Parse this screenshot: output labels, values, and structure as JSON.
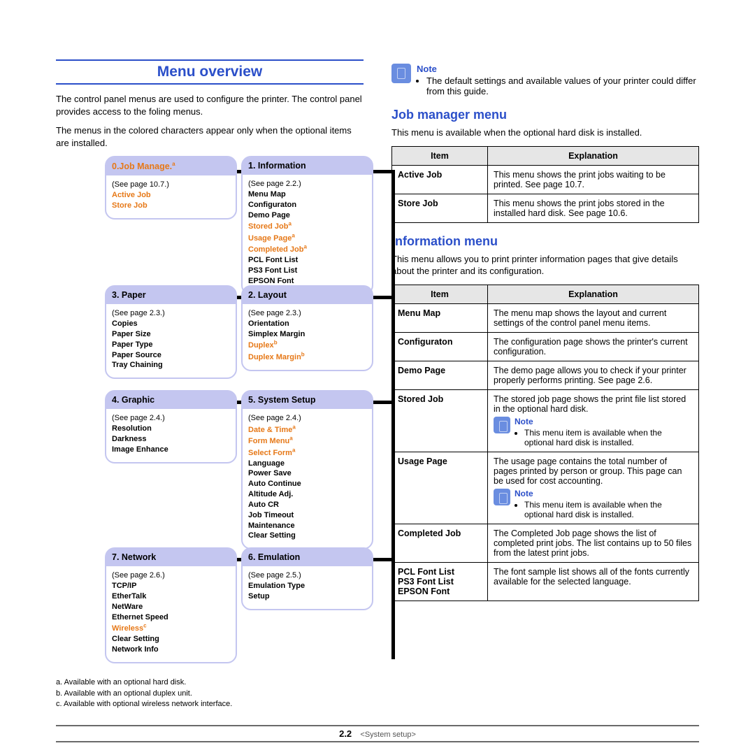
{
  "main_title": "Menu overview",
  "intro_p1": "The control panel menus are used to configure the printer. The control panel provides access to the foling menus.",
  "intro_p2": "The menus in the colored characters appear only when the optional items are installed.",
  "boxes": {
    "b0": {
      "title": "0.Job Manage.",
      "sup": "a",
      "ref": "(See page 10.7.)",
      "items": [
        {
          "t": "Active Job",
          "orange": true
        },
        {
          "t": "Store Job",
          "orange": true
        }
      ]
    },
    "b1": {
      "title": "1. Information",
      "ref": "(See page 2.2.)",
      "items": [
        {
          "t": "Menu Map"
        },
        {
          "t": "Configuraton"
        },
        {
          "t": "Demo Page"
        },
        {
          "t": "Stored Job",
          "orange": true,
          "sup": "a"
        },
        {
          "t": "Usage Page",
          "orange": true,
          "sup": "a"
        },
        {
          "t": "Completed Job",
          "orange": true,
          "sup": "a"
        },
        {
          "t": "PCL Font List"
        },
        {
          "t": "PS3 Font List"
        },
        {
          "t": "EPSON Font"
        }
      ]
    },
    "b2": {
      "title": "2. Layout",
      "ref": "(See page 2.3.)",
      "items": [
        {
          "t": "Orientation"
        },
        {
          "t": "Simplex Margin"
        },
        {
          "t": "Duplex",
          "orange": true,
          "sup": "b"
        },
        {
          "t": "Duplex Margin",
          "orange": true,
          "sup": "b"
        }
      ]
    },
    "b3": {
      "title": "3. Paper",
      "ref": "(See page 2.3.)",
      "items": [
        {
          "t": "Copies"
        },
        {
          "t": "Paper Size"
        },
        {
          "t": "Paper Type"
        },
        {
          "t": "Paper Source"
        },
        {
          "t": "Tray Chaining"
        }
      ]
    },
    "b4": {
      "title": "4. Graphic",
      "ref": "(See page 2.4.)",
      "items": [
        {
          "t": "Resolution"
        },
        {
          "t": "Darkness"
        },
        {
          "t": "Image Enhance"
        }
      ]
    },
    "b5": {
      "title": "5. System Setup",
      "ref": "(See page 2.4.)",
      "items": [
        {
          "t": "Date & Time",
          "orange": true,
          "sup": "a"
        },
        {
          "t": "Form Menu",
          "orange": true,
          "sup": "a"
        },
        {
          "t": "Select Form",
          "orange": true,
          "sup": "a"
        },
        {
          "t": "Language"
        },
        {
          "t": "Power Save"
        },
        {
          "t": "Auto Continue"
        },
        {
          "t": "Altitude Adj."
        },
        {
          "t": "Auto CR"
        },
        {
          "t": "Job Timeout"
        },
        {
          "t": "Maintenance"
        },
        {
          "t": "Clear Setting"
        }
      ]
    },
    "b6": {
      "title": "6. Emulation",
      "ref": "(See page 2.5.)",
      "items": [
        {
          "t": "Emulation Type"
        },
        {
          "t": "Setup"
        }
      ]
    },
    "b7": {
      "title": "7. Network",
      "ref": "(See page 2.6.)",
      "items": [
        {
          "t": "TCP/IP"
        },
        {
          "t": "EtherTalk"
        },
        {
          "t": "NetWare"
        },
        {
          "t": "Ethernet Speed"
        },
        {
          "t": "Wireless",
          "orange": true,
          "sup": "c"
        },
        {
          "t": "Clear Setting"
        },
        {
          "t": "Network Info"
        }
      ]
    }
  },
  "footnotes": {
    "a": "Available with an optional hard disk.",
    "b": "Available with an optional duplex unit.",
    "c": "Available with optional wireless network interface."
  },
  "top_note": {
    "title": "Note",
    "text": "The default settings and available values of your printer could differ from this guide."
  },
  "job_manager": {
    "title": "Job manager menu",
    "desc": "This menu is available when the optional hard disk is installed.",
    "head_item": "Item",
    "head_expl": "Explanation",
    "rows": [
      {
        "item": "Active Job",
        "expl": "This menu shows the print jobs waiting to be printed. See page 10.7."
      },
      {
        "item": "Store Job",
        "expl": "This menu shows the print jobs stored in the installed hard disk. See page 10.6."
      }
    ]
  },
  "information": {
    "title": "Information menu",
    "desc": "This menu allows you to print printer information pages that give details about the printer and its configuration.",
    "head_item": "Item",
    "head_expl": "Explanation",
    "rows": [
      {
        "item": "Menu Map",
        "expl": "The menu map shows the layout and current settings of the control panel menu items."
      },
      {
        "item": "Configuraton",
        "expl": "The configuration page shows the printer's current configuration."
      },
      {
        "item": "Demo Page",
        "expl": "The demo page allows you to check if your printer properly performs printing. See page 2.6."
      },
      {
        "item": "Stored Job",
        "expl": "The stored job page shows the print file list stored in the optional hard disk.",
        "note": "This menu item is available when the optional hard disk is installed."
      },
      {
        "item": "Usage Page",
        "expl": "The usage page contains the total number of pages printed by person or group. This page can be used for cost accounting.",
        "note": "This menu item is available when the optional hard disk is installed."
      },
      {
        "item": "Completed Job",
        "expl": "The Completed Job page shows the list of completed print jobs. The list contains up to 50 files from the latest print jobs."
      },
      {
        "item": "PCL Font List\nPS3 Font List\nEPSON Font",
        "expl": "The font sample list shows all of the fonts currently available for the selected language."
      }
    ]
  },
  "note_label": "Note",
  "footer": {
    "num": "2.2",
    "section": "<System setup>"
  }
}
